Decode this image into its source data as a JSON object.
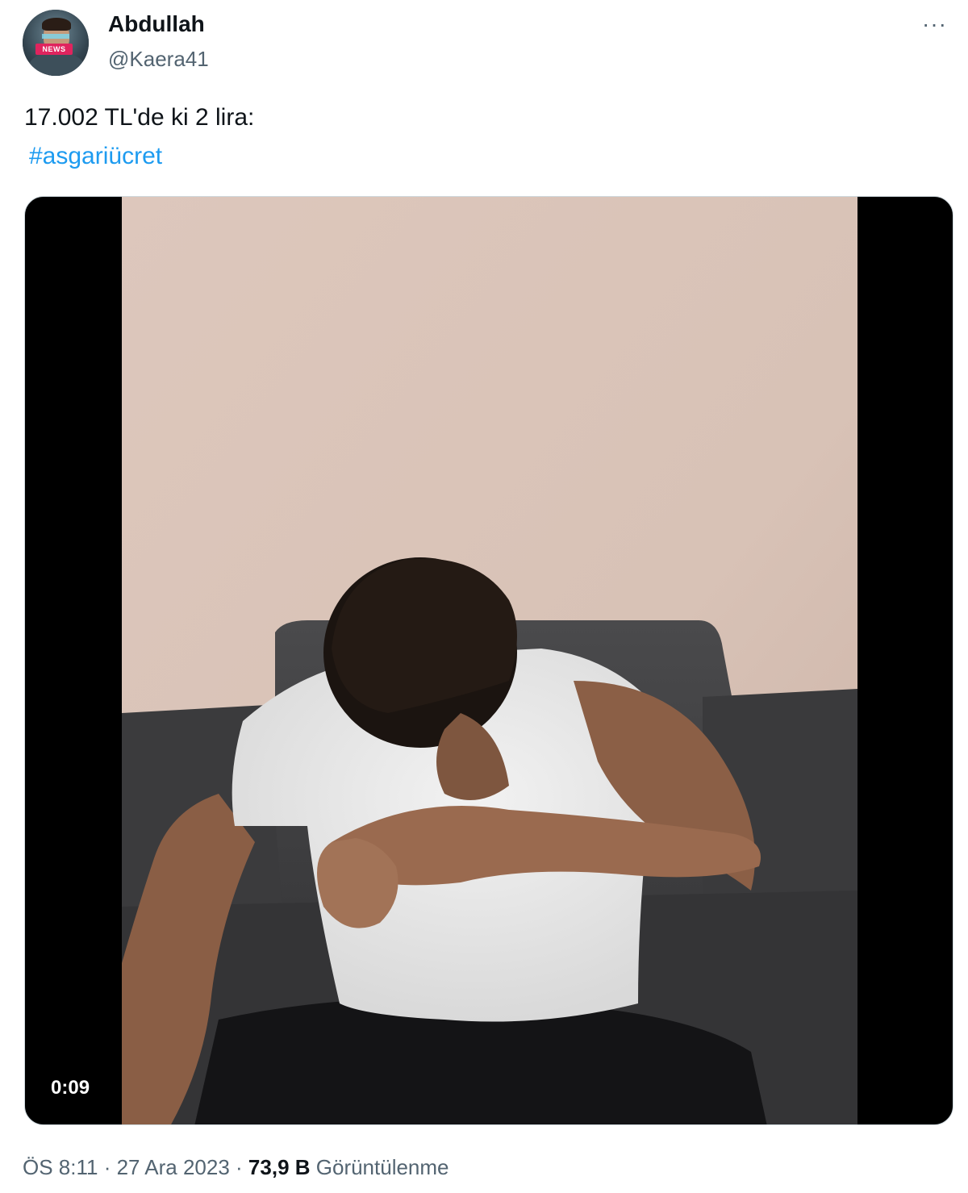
{
  "author": {
    "name": "Abdullah",
    "handle": "@Kaera41",
    "avatar_badge": "NEWS"
  },
  "more_menu": "···",
  "tweet": {
    "text": "17.002 TL'de ki 2 lira:",
    "hashtag": "#asgariücret"
  },
  "media": {
    "duration": "0:09"
  },
  "footer": {
    "time": "ÖS 8:11",
    "sep1": " · ",
    "date": "27 Ara 2023",
    "sep2": " · ",
    "views_count": "73,9 B",
    "views_label": " Görüntülenme"
  },
  "colors": {
    "link": "#1d9bf0",
    "secondary_text": "#536471",
    "primary_text": "#0f1419"
  }
}
